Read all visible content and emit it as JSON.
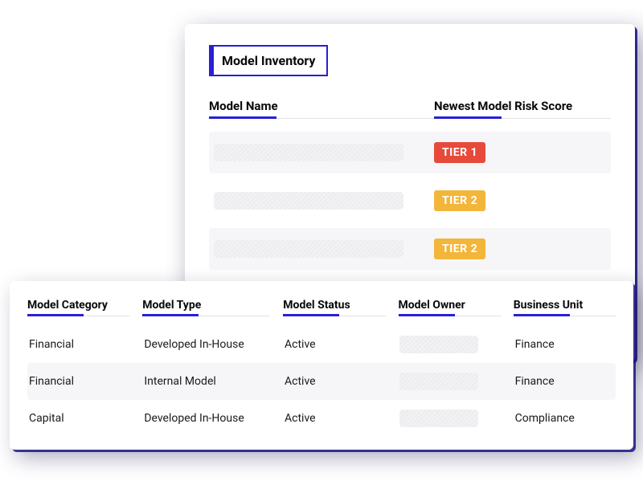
{
  "backCard": {
    "title": "Model Inventory",
    "headers": {
      "modelName": "Model Name",
      "riskScore": "Newest Model Risk Score"
    },
    "rows": [
      {
        "tier": "TIER 1",
        "tierClass": "red"
      },
      {
        "tier": "TIER 2",
        "tierClass": "amber"
      },
      {
        "tier": "TIER 2",
        "tierClass": "amber"
      }
    ]
  },
  "frontCard": {
    "headers": {
      "category": "Model Category",
      "type": "Model Type",
      "status": "Model Status",
      "owner": "Model Owner",
      "unit": "Business Unit"
    },
    "rows": [
      {
        "category": "Financial",
        "type": "Developed In-House",
        "status": "Active",
        "unit": "Finance"
      },
      {
        "category": "Financial",
        "type": "Internal Model",
        "status": "Active",
        "unit": "Finance"
      },
      {
        "category": "Capital",
        "type": "Developed In-House",
        "status": "Active",
        "unit": "Compliance"
      }
    ]
  }
}
